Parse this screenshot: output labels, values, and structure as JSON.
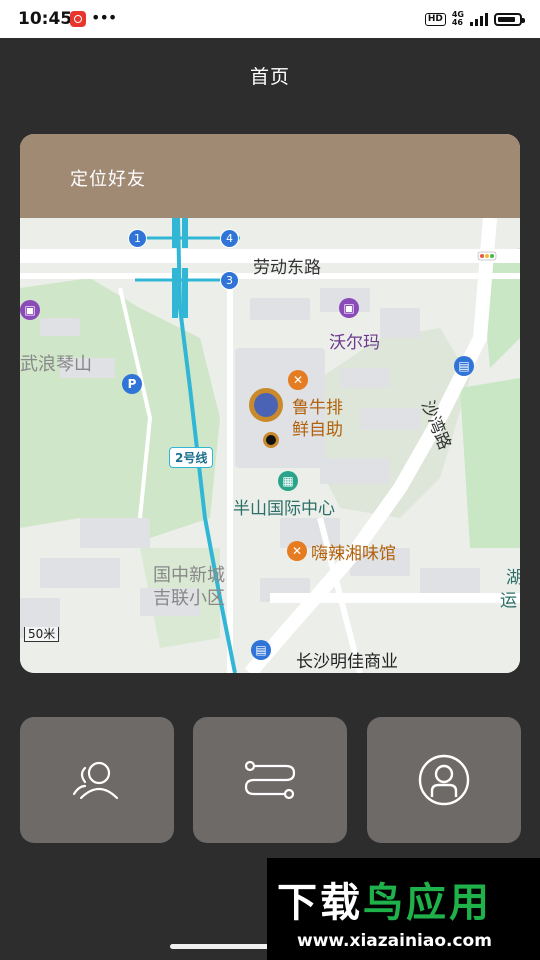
{
  "status_bar": {
    "time": "10:45",
    "dots": "•••",
    "hd": "HD",
    "network_top": "4G",
    "network_bottom": "46",
    "icons": [
      "app-notification-icon",
      "signal-icon",
      "battery-icon"
    ]
  },
  "header": {
    "title": "首页"
  },
  "card": {
    "title": "定位好友",
    "map": {
      "roads": [
        "劳动东路",
        "沙湾路"
      ],
      "metro_line": "2号线",
      "metro_exits": [
        "1",
        "4",
        "3"
      ],
      "places": {
        "walmart": "沃尔玛",
        "hill_park": "武浪琴山",
        "restaurant_line1": "鲁牛排",
        "restaurant_line2": "鲜自助",
        "center": "半山国际中心",
        "hunan_restaurant": "嗨辣湘味馆",
        "district_line1": "国中新城",
        "district_line2": "吉联小区",
        "mall": "长沙明佳商业",
        "edge_right_1": "湖",
        "edge_right_2": "运"
      },
      "scale": "50米",
      "parking": "P"
    }
  },
  "actions": [
    {
      "name": "friends",
      "icon": "friends-icon"
    },
    {
      "name": "route",
      "icon": "route-icon"
    },
    {
      "name": "profile",
      "icon": "profile-icon"
    }
  ],
  "watermark": {
    "title_part1": "下载",
    "title_part2": "鸟应用",
    "url": "www.xiazainiao.com"
  },
  "colors": {
    "background": "#2d2d2d",
    "card_header": "#a08a74",
    "action_button": "#6e6a68",
    "metro_line": "#32b6d6"
  }
}
